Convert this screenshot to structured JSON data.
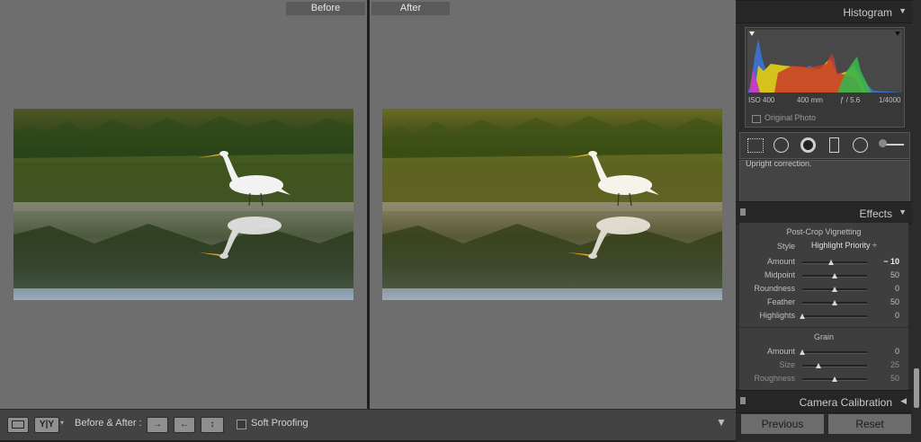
{
  "view": {
    "before_label": "Before",
    "after_label": "After"
  },
  "toolbar": {
    "loupe_icon": "single-view-icon",
    "compare_glyph": "Y|Y",
    "before_after_label": "Before & After :",
    "copy_before_to_after_glyph": "→",
    "copy_after_to_before_glyph": "←",
    "swap_glyph": "↕",
    "soft_proofing_label": "Soft Proofing",
    "menu_arrow": "▼"
  },
  "histogram": {
    "title": "Histogram",
    "iso": "ISO 400",
    "focal_length": "400 mm",
    "aperture": "ƒ / 5.6",
    "shutter": "1/4000",
    "original_photo_label": "Original Photo"
  },
  "upright_text": "Upright correction.",
  "effects": {
    "title": "Effects",
    "vignette": {
      "title": "Post-Crop Vignetting",
      "style_label": "Style",
      "style_value": "Highlight Priority ÷",
      "rows": [
        {
          "label": "Amount",
          "value": "− 10",
          "level": 0.45
        },
        {
          "label": "Midpoint",
          "value": "50",
          "level": 0.5
        },
        {
          "label": "Roundness",
          "value": "0",
          "level": 0.5
        },
        {
          "label": "Feather",
          "value": "50",
          "level": 0.5
        },
        {
          "label": "Highlights",
          "value": "0",
          "level": 0.0
        }
      ]
    },
    "grain": {
      "title": "Grain",
      "rows": [
        {
          "label": "Amount",
          "value": "0",
          "level": 0.0
        },
        {
          "label": "Size",
          "value": "25",
          "level": 0.25
        },
        {
          "label": "Roughness",
          "value": "50",
          "level": 0.5
        }
      ]
    }
  },
  "camera_calibration": {
    "title": "Camera Calibration"
  },
  "buttons": {
    "previous_label": "Previous",
    "reset_label": "Reset"
  },
  "colors": {
    "viewport_bg": "#6e6e6e",
    "panel_bg": "#2b2b2b"
  }
}
